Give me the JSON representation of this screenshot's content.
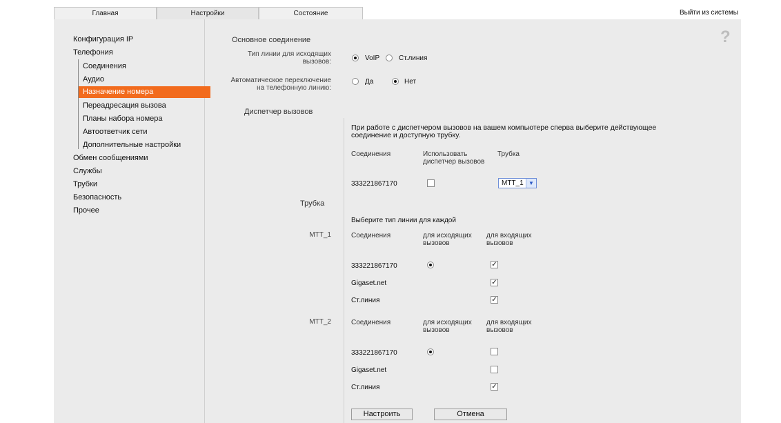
{
  "tabs": [
    {
      "label": "Главная"
    },
    {
      "label": "Настройки"
    },
    {
      "label": "Состояние"
    }
  ],
  "logout_label": "Выйти из системы",
  "help_icon": "question-icon",
  "sidebar": {
    "items": [
      {
        "label": "Конфигурация IP"
      },
      {
        "label": "Телефония"
      },
      {
        "label": "Соединения"
      },
      {
        "label": "Аудио"
      },
      {
        "label": "Назначение номера"
      },
      {
        "label": "Переадресация вызова"
      },
      {
        "label": "Планы набора номера"
      },
      {
        "label": "Автоответчик сети"
      },
      {
        "label": "Дополнительные настройки"
      },
      {
        "label": "Обмен сообщениями"
      },
      {
        "label": "Службы"
      },
      {
        "label": "Трубки"
      },
      {
        "label": "Безопасность"
      },
      {
        "label": "Прочее"
      }
    ],
    "active_color": "#f26b1d"
  },
  "main": {
    "section_main": "Основное соединение",
    "line_type_label": "Тип линии для исходящих вызовов:",
    "line_type_options": [
      "VoIP",
      "Ст.линия"
    ],
    "line_type_selected": "VoIP",
    "auto_switch_label": "Автоматическое переключение на телефонную линию:",
    "auto_switch_options": [
      "Да",
      "Нет"
    ],
    "auto_switch_selected": "Нет",
    "section_dispatcher": "Диспетчер вызовов",
    "dispatcher_info": "При работе с диспетчером вызовов на вашем компьютере сперва выберите действующее соединение и доступную трубку.",
    "dispatcher_headers": {
      "connection": "Соединения",
      "use": "Использовать диспетчер вызовов",
      "handset": "Трубка"
    },
    "dispatcher_row": {
      "connection": "333221867170",
      "use_checked": false,
      "handset": "MTT_1"
    },
    "section_handset": "Трубка",
    "handset_info": "Выберите тип линии для каждой",
    "handset_headers": {
      "connection": "Соединения",
      "outgoing": "для исходящих вызовов",
      "incoming": "для входящих вызовов"
    },
    "handsets": [
      {
        "name": "MTT_1",
        "rows": [
          {
            "connection": "333221867170",
            "outgoing_radio": true,
            "incoming_checked": true
          },
          {
            "connection": "Gigaset.net",
            "outgoing_radio": false,
            "incoming_checked": true
          },
          {
            "connection": "Ст.линия",
            "outgoing_radio": false,
            "incoming_checked": true
          }
        ]
      },
      {
        "name": "MTT_2",
        "rows": [
          {
            "connection": "333221867170",
            "outgoing_radio": true,
            "incoming_checked": false
          },
          {
            "connection": "Gigaset.net",
            "outgoing_radio": false,
            "incoming_checked": false
          },
          {
            "connection": "Ст.линия",
            "outgoing_radio": false,
            "incoming_checked": true
          }
        ]
      }
    ],
    "apply_label": "Настроить",
    "cancel_label": "Отмена"
  }
}
